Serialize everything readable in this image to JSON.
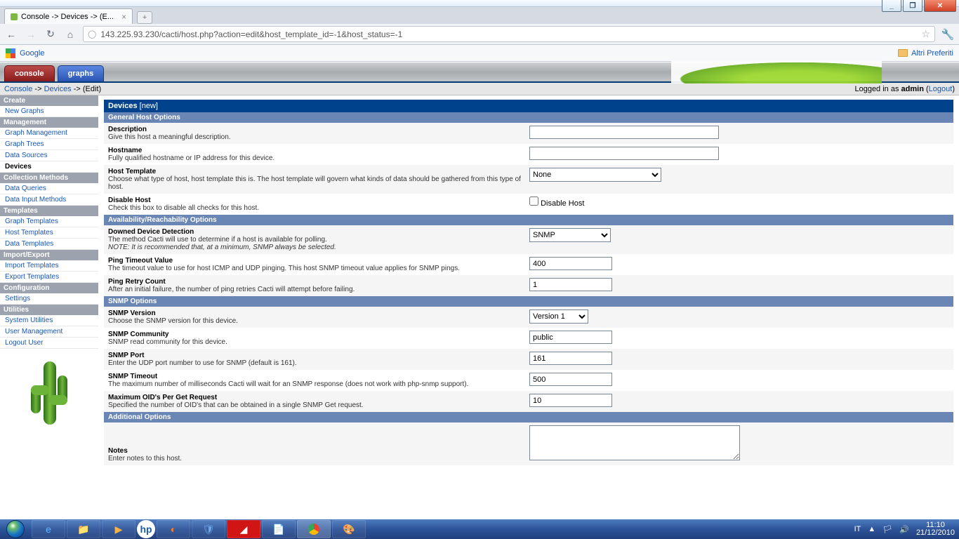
{
  "window": {
    "tabTitle": "Console -> Devices -> (E...",
    "newTab": "+",
    "minGlyph": "_",
    "maxGlyph": "❐",
    "closeGlyph": "✕"
  },
  "toolbar": {
    "back": "←",
    "fwd": "→",
    "reload": "↻",
    "home": "⌂",
    "globe": "◯",
    "url": "143.225.93.230/cacti/host.php?action=edit&host_template_id=-1&host_status=-1",
    "star": "☆",
    "wrench": "🔧"
  },
  "bookmarks": {
    "google": "Google",
    "altri": "Altri Preferiti"
  },
  "header": {
    "console": "console",
    "graphs": "graphs"
  },
  "crumb": {
    "a": "Console",
    "sep": " -> ",
    "b": "Devices",
    "c": " -> (Edit)",
    "logged": "Logged in as ",
    "user": "admin",
    "open": " (",
    "logout": "Logout",
    "close": ")"
  },
  "sidebar": {
    "h": [
      "Create",
      "Management",
      "Collection Methods",
      "Templates",
      "Import/Export",
      "Configuration",
      "Utilities"
    ],
    "l": {
      "newGraphs": "New Graphs",
      "graphMgmt": "Graph Management",
      "graphTrees": "Graph Trees",
      "dataSources": "Data Sources",
      "devices": "Devices",
      "dataQueries": "Data Queries",
      "dataInput": "Data Input Methods",
      "graphTpl": "Graph Templates",
      "hostTpl": "Host Templates",
      "dataTpl": "Data Templates",
      "importTpl": "Import Templates",
      "exportTpl": "Export Templates",
      "settings": "Settings",
      "sysUtil": "System Utilities",
      "userMgmt": "User Management",
      "logout": "Logout User"
    }
  },
  "form": {
    "title": "Devices",
    "titleSub": " [new]",
    "sectGen": "General Host Options",
    "sectAvail": "Availability/Reachability Options",
    "sectSnmp": "SNMP Options",
    "sectAdd": "Additional Options",
    "desc": {
      "t": "Description",
      "d": "Give this host a meaningful description.",
      "v": ""
    },
    "hostname": {
      "t": "Hostname",
      "d": "Fully qualified hostname or IP address for this device.",
      "v": ""
    },
    "tpl": {
      "t": "Host Template",
      "d": "Choose what type of host, host template this is. The host template will govern what kinds of data should be gathered from this type of host.",
      "v": "None"
    },
    "disable": {
      "t": "Disable Host",
      "d": "Check this box to disable all checks for this host.",
      "cb": "Disable Host"
    },
    "downed": {
      "t": "Downed Device Detection",
      "d": "The method Cacti will use to determine if a host is available for polling.",
      "n": "NOTE: It is recommended that, at a minimum, SNMP always be selected.",
      "v": "SNMP"
    },
    "pingTimeout": {
      "t": "Ping Timeout Value",
      "d": "The timeout value to use for host ICMP and UDP pinging. This host SNMP timeout value applies for SNMP pings.",
      "v": "400"
    },
    "pingRetry": {
      "t": "Ping Retry Count",
      "d": "After an initial failure, the number of ping retries Cacti will attempt before failing.",
      "v": "1"
    },
    "snmpVer": {
      "t": "SNMP Version",
      "d": "Choose the SNMP version for this device.",
      "v": "Version 1"
    },
    "snmpComm": {
      "t": "SNMP Community",
      "d": "SNMP read community for this device.",
      "v": "public"
    },
    "snmpPort": {
      "t": "SNMP Port",
      "d": "Enter the UDP port number to use for SNMP (default is 161).",
      "v": "161"
    },
    "snmpTimeout": {
      "t": "SNMP Timeout",
      "d": "The maximum number of milliseconds Cacti will wait for an SNMP response (does not work with php-snmp support).",
      "v": "500"
    },
    "maxOid": {
      "t": "Maximum OID's Per Get Request",
      "d": "Specified the number of OID's that can be obtained in a single SNMP Get request.",
      "v": "10"
    },
    "notes": {
      "t": "Notes",
      "d": "Enter notes to this host.",
      "v": ""
    }
  },
  "tray": {
    "lang": "IT",
    "flag": "▲",
    "net": "🏳",
    "snd": "🔊",
    "time": "11:10",
    "date": "21/12/2010"
  },
  "taskIcons": [
    "e",
    "📁",
    "▶",
    "hp",
    "◐",
    "🛡",
    "◢",
    "📄",
    "◯",
    "🎨"
  ]
}
